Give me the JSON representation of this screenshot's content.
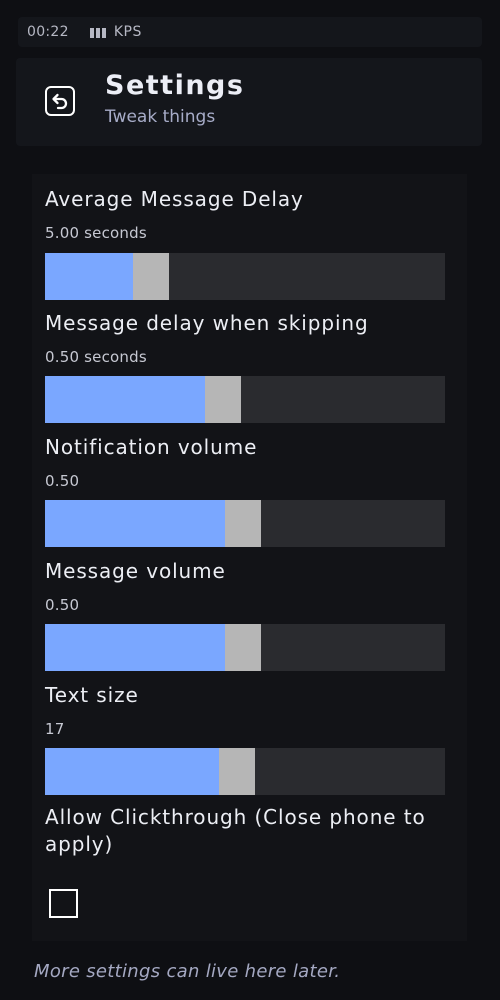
{
  "status_bar": {
    "time": "00:22",
    "carrier": "KPS"
  },
  "header": {
    "title": "Settings",
    "subtitle": "Tweak things",
    "back_icon": "back-arrow-icon"
  },
  "settings": [
    {
      "label": "Average Message Delay",
      "value": "5.00 seconds",
      "fraction": 0.22
    },
    {
      "label": "Message delay when skipping",
      "value": "0.50 seconds",
      "fraction": 0.4
    },
    {
      "label": "Notification volume",
      "value": "0.50",
      "fraction": 0.45
    },
    {
      "label": "Message volume",
      "value": "0.50",
      "fraction": 0.45
    },
    {
      "label": "Text size",
      "value": "17",
      "fraction": 0.435
    }
  ],
  "clickthrough": {
    "label": "Allow Clickthrough (Close phone to apply)",
    "checked": false
  },
  "footer": {
    "note": "More settings can live here later."
  },
  "colors": {
    "accent": "#7aa7ff",
    "thumb": "#b6b6b6",
    "track": "#2a2b2f",
    "background": "#0e0f13"
  }
}
